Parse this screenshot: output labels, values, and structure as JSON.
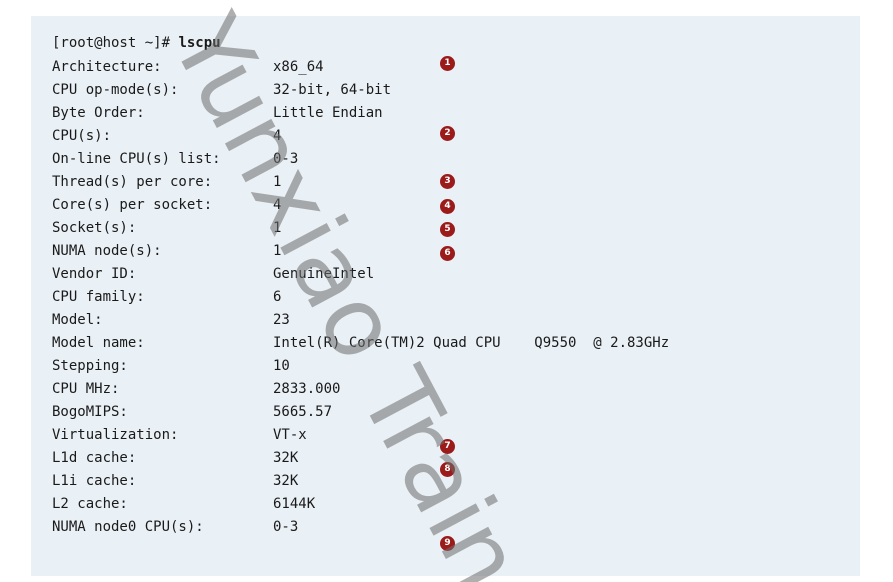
{
  "terminal": {
    "prompt": "[root@host ~]# ",
    "command": "lscpu",
    "rows": [
      {
        "key": "Architecture:",
        "value": "x86_64"
      },
      {
        "key": "CPU op-mode(s):",
        "value": "32-bit, 64-bit"
      },
      {
        "key": "Byte Order:",
        "value": "Little Endian"
      },
      {
        "key": "CPU(s):",
        "value": "4"
      },
      {
        "key": "On-line CPU(s) list:",
        "value": "0-3"
      },
      {
        "key": "Thread(s) per core:",
        "value": "1"
      },
      {
        "key": "Core(s) per socket:",
        "value": "4"
      },
      {
        "key": "Socket(s):",
        "value": "1"
      },
      {
        "key": "NUMA node(s):",
        "value": "1"
      },
      {
        "key": "Vendor ID:",
        "value": "GenuineIntel"
      },
      {
        "key": "CPU family:",
        "value": "6"
      },
      {
        "key": "Model:",
        "value": "23"
      },
      {
        "key": "Model name:",
        "value": "Intel(R) Core(TM)2 Quad CPU    Q9550  @ 2.83GHz"
      },
      {
        "key": "Stepping:",
        "value": "10"
      },
      {
        "key": "CPU MHz:",
        "value": "2833.000"
      },
      {
        "key": "BogoMIPS:",
        "value": "5665.57"
      },
      {
        "key": "Virtualization:",
        "value": "VT-x"
      },
      {
        "key": "L1d cache:",
        "value": "32K"
      },
      {
        "key": "L1i cache:",
        "value": "32K"
      },
      {
        "key": "L2 cache:",
        "value": "6144K"
      },
      {
        "key": "NUMA node0 CPU(s):",
        "value": "0-3"
      }
    ]
  },
  "callouts": [
    "1",
    "2",
    "3",
    "4",
    "5",
    "6",
    "7",
    "8",
    "9"
  ],
  "watermark": "Yunxiao Train",
  "colors": {
    "terminal_bg": "#e9f0f6",
    "callout": "#9b1b1b",
    "text": "#1a1a1a"
  }
}
